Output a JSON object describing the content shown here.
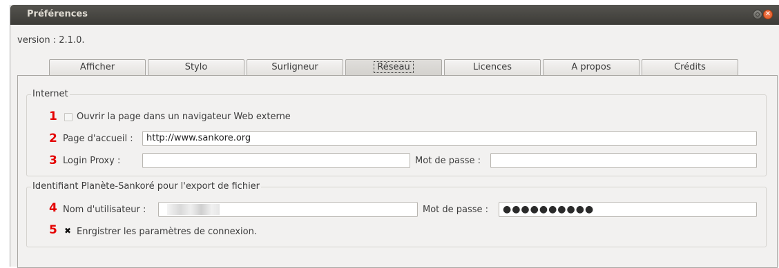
{
  "window": {
    "title": "Préférences"
  },
  "version": "version : 2.1.0.",
  "tabs": [
    {
      "label": "Afficher",
      "active": false
    },
    {
      "label": "Stylo",
      "active": false
    },
    {
      "label": "Surligneur",
      "active": false
    },
    {
      "label": "Réseau",
      "active": true
    },
    {
      "label": "Licences",
      "active": false
    },
    {
      "label": "A propos",
      "active": false
    },
    {
      "label": "Crédits",
      "active": false
    }
  ],
  "internet": {
    "title": "Internet",
    "open_external": {
      "number": "1",
      "label": "Ouvrir la page dans un navigateur Web externe",
      "checked": false
    },
    "home_page": {
      "number": "2",
      "label": "Page d'accueil :",
      "value": "http://www.sankore.org"
    },
    "proxy": {
      "number": "3",
      "label": "Login Proxy :",
      "value": "",
      "password_label": "Mot de passe :",
      "password_value": ""
    }
  },
  "planete": {
    "title": "Identifiant Planète-Sankoré pour l'export de fichier",
    "username": {
      "number": "4",
      "label": "Nom d'utilisateur :",
      "value": ""
    },
    "password": {
      "label": "Mot de passe :",
      "value": "●●●●●●●●●●"
    },
    "save": {
      "number": "5",
      "label": "Enrgistrer les paramètres de connexion.",
      "checked": true,
      "mark": "✖"
    }
  },
  "colors": {
    "accent_number": "#e40000",
    "titlebar": "#3c3b37",
    "close_button": "#e05a24"
  },
  "icons": {
    "minimize": "minimize-icon",
    "close": "close-icon"
  }
}
